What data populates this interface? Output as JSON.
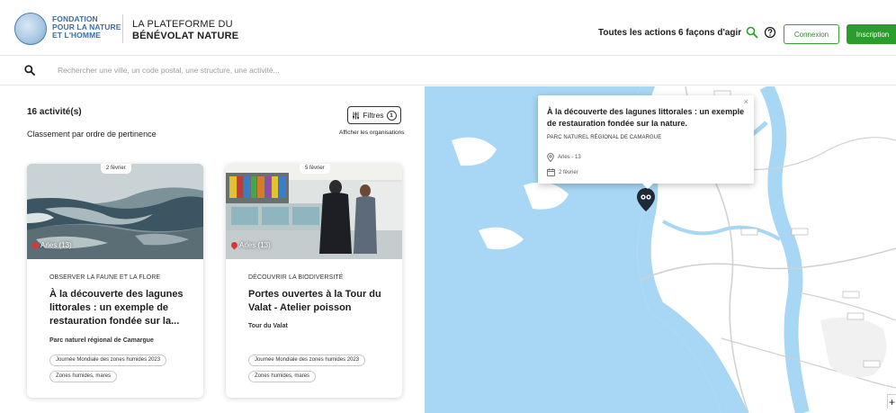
{
  "header": {
    "logo_lines": [
      "FONDATION",
      "POUR LA NATURE",
      "ET L'HOMME"
    ],
    "platform_line1": "LA PLATEFORME DU",
    "platform_line2": "BÉNÉVOLAT NATURE",
    "nav_all": "Toutes les actions",
    "nav_ways": "6 façons d'agir",
    "login_label": "Connexion",
    "signup_label": "Inscription",
    "accent_color": "#2a9d2a"
  },
  "search": {
    "placeholder": "Rechercher une ville, un code postal, une structure, une activité..."
  },
  "results": {
    "count": "16 activité(s)",
    "sort": "Classement par ordre de pertinence",
    "filters_label": "Filtres",
    "filters_count": "1",
    "show_orgs": "Afficher les organisations"
  },
  "cards": [
    {
      "date": "2 février",
      "location": "Arles (13)",
      "category": "OBSERVER LA FAUNE ET LA FLORE",
      "title": "À la découverte des lagunes littorales : un exemple de restauration fondée sur la...",
      "org": "Parc naturel régional de Camargue",
      "tags": [
        "Journée Mondiale des zones humides 2023",
        "Zones humides, mares"
      ]
    },
    {
      "date": "5 février",
      "location": "Arles (13)",
      "category": "DÉCOUVRIR LA BIODIVERSITÉ",
      "title": "Portes ouvertes à la Tour du Valat - Atelier poisson",
      "org": "Tour du Valat",
      "tags": [
        "Journée Mondiale des zones humides 2023",
        "Zones humides, mares"
      ]
    }
  ],
  "map": {
    "popup": {
      "close": "×",
      "title": "À la découverte des lagunes littorales : un exemple de restauration fondée sur la nature.",
      "org": "PARC NATUREL RÉGIONAL DE CAMARGUE",
      "location": "Arles - 13",
      "date": "2 février"
    },
    "zoom_in": "+",
    "water_color": "#a7d7f4",
    "land_color": "#ffffff"
  }
}
